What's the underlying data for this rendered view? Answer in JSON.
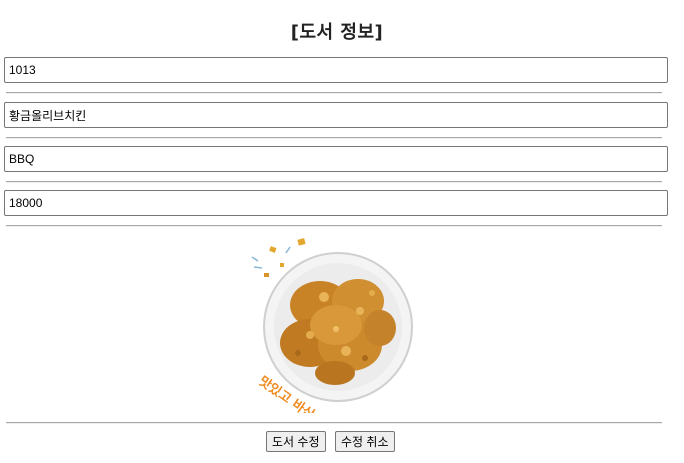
{
  "page": {
    "title": "[도서 정보]"
  },
  "form": {
    "fields": [
      {
        "value": "1013"
      },
      {
        "value": "황금올리브치킨"
      },
      {
        "value": "BBQ"
      },
      {
        "value": "18000"
      }
    ],
    "image_caption": "맛있고 바삭!"
  },
  "buttons": {
    "update_label": "도서 수정",
    "cancel_label": "수정 취소"
  },
  "colors": {
    "chicken": "#c9852a",
    "caption": "#f08a1e",
    "plate": "#e9e9e9"
  }
}
